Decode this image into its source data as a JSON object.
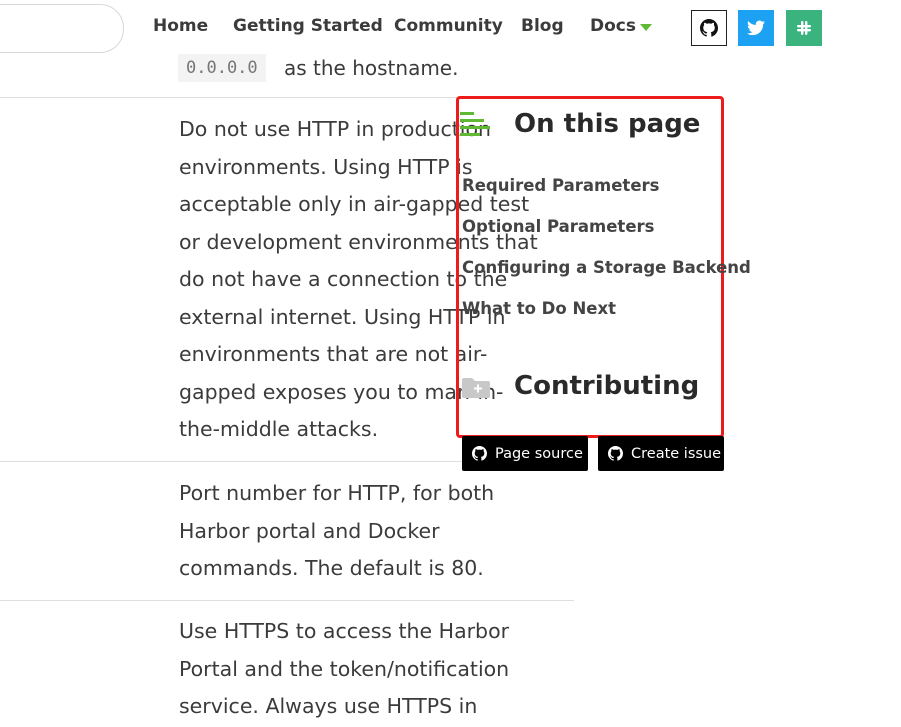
{
  "nav": {
    "search_placeholder": "",
    "links": [
      "Home",
      "Getting Started",
      "Community",
      "Blog",
      "Docs"
    ],
    "social": [
      "github-icon",
      "twitter-icon",
      "slack-icon"
    ]
  },
  "content": {
    "hostname_code": "0.0.0.0",
    "hostname_suffix": "as the hostname.",
    "para_http_warning": "Do not use HTTP in production\nenvironments. Using HTTP is\nacceptable only in air-gapped test\nor development environments that\ndo not have a connection to the\nexternal internet. Using HTTP in\nenvironments that are not air-\ngapped exposes you to man-in-\nthe-middle attacks.",
    "para_port": "Port number for HTTP, for both\nHarbor portal and Docker\ncommands. The default is 80.",
    "para_https": "Use HTTPS to access the Harbor\nPortal and the token/notification\nservice. Always use HTTPS in"
  },
  "toc": {
    "title": "On this page",
    "links": [
      "Required Parameters",
      "Optional Parameters",
      "Configuring a Storage Backend",
      "What to Do Next"
    ],
    "contributing_title": "Contributing",
    "page_source": "Page source",
    "create_issue": "Create issue"
  },
  "colors": {
    "accent_green": "#60b932",
    "highlight_red": "#ee1b1b",
    "twitter": "#1da1f2",
    "slack": "#3bb37e"
  }
}
